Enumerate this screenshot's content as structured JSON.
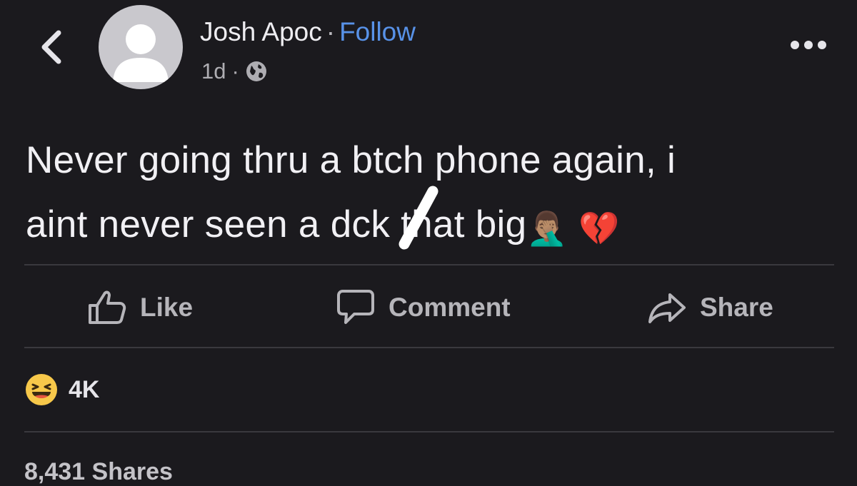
{
  "header": {
    "author_name": "Josh Apoc",
    "separator": "·",
    "follow_label": "Follow",
    "timestamp": "1d",
    "meta_separator": "·",
    "privacy_icon": "globe-icon",
    "back_icon": "chevron-left-icon",
    "more_icon": "more-options-icon"
  },
  "post": {
    "line1": "Never going thru a btch phone again, i",
    "line2_before": "aint never seen a d",
    "line2_after": "ck that big",
    "emoji_facepalm": "🤦🏽‍♂️",
    "emoji_broken_heart": "💔"
  },
  "actions": {
    "like_label": "Like",
    "comment_label": "Comment",
    "share_label": "Share"
  },
  "reactions": {
    "type": "laughing",
    "count": "4K"
  },
  "footer": {
    "shares_text": "8,431 Shares"
  },
  "colors": {
    "background": "#1b1a1e",
    "follow": "#5892e8",
    "text": "#f1f0f4",
    "muted": "#b6b5ba",
    "divider": "#3a393e"
  }
}
